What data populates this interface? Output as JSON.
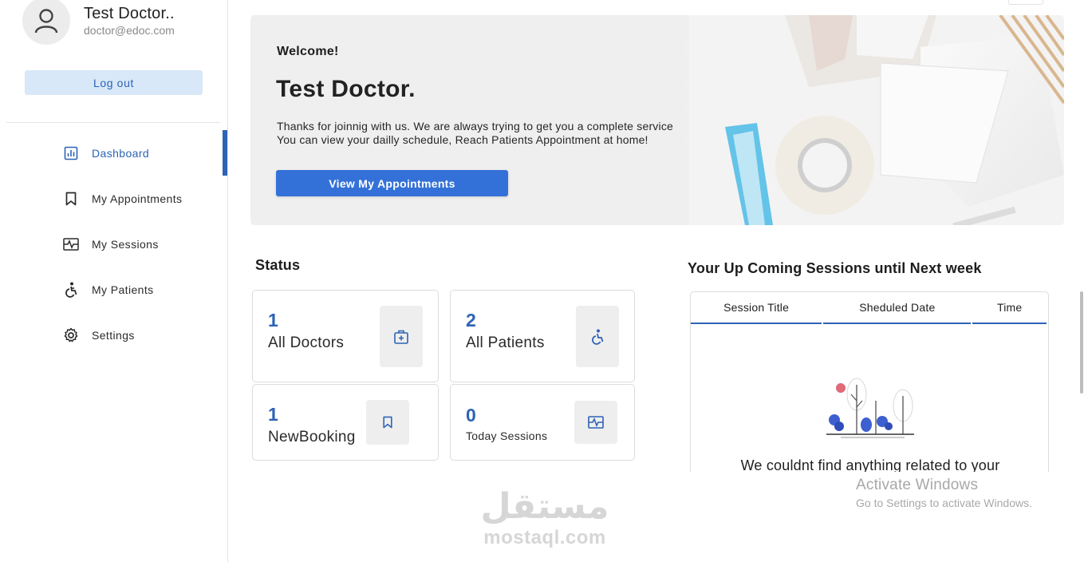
{
  "profile": {
    "name": "Test Doctor..",
    "email": "doctor@edoc.com",
    "avatar_icon": "user-avatar-icon"
  },
  "sidebar": {
    "logout_label": "Log out",
    "items": [
      {
        "label": "Dashboard",
        "icon": "dashboard-icon",
        "active": true
      },
      {
        "label": "My Appointments",
        "icon": "bookmark-icon",
        "active": false
      },
      {
        "label": "My Sessions",
        "icon": "sessions-icon",
        "active": false
      },
      {
        "label": "My Patients",
        "icon": "patient-icon",
        "active": false
      },
      {
        "label": "Settings",
        "icon": "gear-icon",
        "active": false
      }
    ]
  },
  "banner": {
    "welcome": "Welcome!",
    "doctor_name": "Test Doctor.",
    "message_line1": "Thanks for joinnig with us. We are always trying to get you a complete service",
    "message_line2": "You can view your dailly schedule, Reach Patients Appointment at home!",
    "button_label": "View My Appointments"
  },
  "status": {
    "title": "Status",
    "cards": [
      {
        "value": "1",
        "label": "All Doctors",
        "icon": "doctor-case-icon"
      },
      {
        "value": "2",
        "label": "All Patients",
        "icon": "patient-icon"
      },
      {
        "value": "1",
        "label": "NewBooking",
        "icon": "bookmark-icon"
      },
      {
        "value": "0",
        "label": "Today Sessions",
        "icon": "sessions-icon"
      }
    ]
  },
  "upcoming": {
    "title": "Your Up Coming Sessions until Next week",
    "columns": [
      "Session Title",
      "Sheduled Date",
      "Time"
    ],
    "empty_message": "We couldnt find anything related to your"
  },
  "watermark": {
    "windows_title": "Activate Windows",
    "windows_sub": "Go to Settings to activate Windows.",
    "brand_ar": "مستقل",
    "brand_en": "mostaql.com"
  },
  "colors": {
    "accent": "#2d63b5",
    "button": "#3371d8",
    "logout_bg": "#d8e8f8"
  }
}
